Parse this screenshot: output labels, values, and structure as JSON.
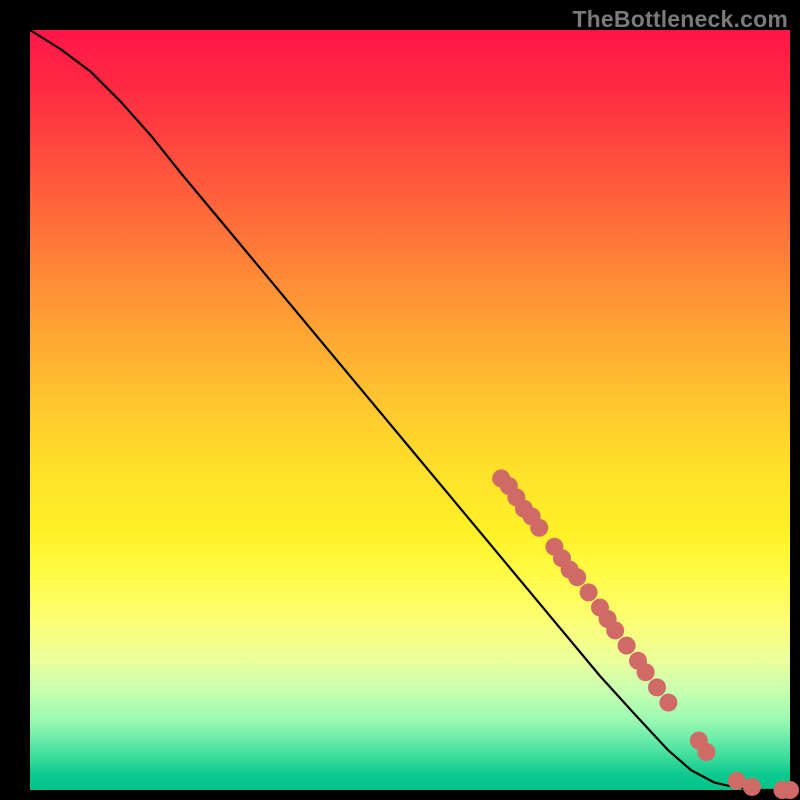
{
  "attribution_text": "TheBottleneck.com",
  "chart_data": {
    "type": "line",
    "title": "",
    "xlabel": "",
    "ylabel": "",
    "xlim": [
      0,
      100
    ],
    "ylim": [
      0,
      100
    ],
    "curve": [
      {
        "x": 0,
        "y": 100
      },
      {
        "x": 4,
        "y": 97.5
      },
      {
        "x": 8,
        "y": 94.5
      },
      {
        "x": 12,
        "y": 90.5
      },
      {
        "x": 16,
        "y": 86
      },
      {
        "x": 20,
        "y": 81
      },
      {
        "x": 25,
        "y": 75
      },
      {
        "x": 30,
        "y": 69
      },
      {
        "x": 35,
        "y": 63
      },
      {
        "x": 40,
        "y": 57
      },
      {
        "x": 45,
        "y": 51
      },
      {
        "x": 50,
        "y": 45
      },
      {
        "x": 55,
        "y": 39
      },
      {
        "x": 60,
        "y": 33
      },
      {
        "x": 65,
        "y": 27
      },
      {
        "x": 70,
        "y": 21
      },
      {
        "x": 75,
        "y": 15
      },
      {
        "x": 80,
        "y": 9.5
      },
      {
        "x": 84,
        "y": 5.2
      },
      {
        "x": 87,
        "y": 2.6
      },
      {
        "x": 90,
        "y": 1.0
      },
      {
        "x": 93,
        "y": 0.3
      },
      {
        "x": 96,
        "y": 0
      },
      {
        "x": 100,
        "y": 0
      }
    ],
    "scatter": [
      {
        "x": 62,
        "y": 41
      },
      {
        "x": 63,
        "y": 40
      },
      {
        "x": 64,
        "y": 38.5
      },
      {
        "x": 65,
        "y": 37
      },
      {
        "x": 66,
        "y": 36
      },
      {
        "x": 67,
        "y": 34.5
      },
      {
        "x": 69,
        "y": 32
      },
      {
        "x": 70,
        "y": 30.5
      },
      {
        "x": 71,
        "y": 29
      },
      {
        "x": 72,
        "y": 28
      },
      {
        "x": 73.5,
        "y": 26
      },
      {
        "x": 75,
        "y": 24
      },
      {
        "x": 76,
        "y": 22.5
      },
      {
        "x": 77,
        "y": 21
      },
      {
        "x": 78.5,
        "y": 19
      },
      {
        "x": 80,
        "y": 17
      },
      {
        "x": 81,
        "y": 15.5
      },
      {
        "x": 82.5,
        "y": 13.5
      },
      {
        "x": 84,
        "y": 11.5
      },
      {
        "x": 88,
        "y": 6.5
      },
      {
        "x": 89,
        "y": 5
      },
      {
        "x": 93,
        "y": 1.2
      },
      {
        "x": 95,
        "y": 0.4
      },
      {
        "x": 99,
        "y": 0
      },
      {
        "x": 100,
        "y": 0
      }
    ],
    "dot_radius": 9
  }
}
